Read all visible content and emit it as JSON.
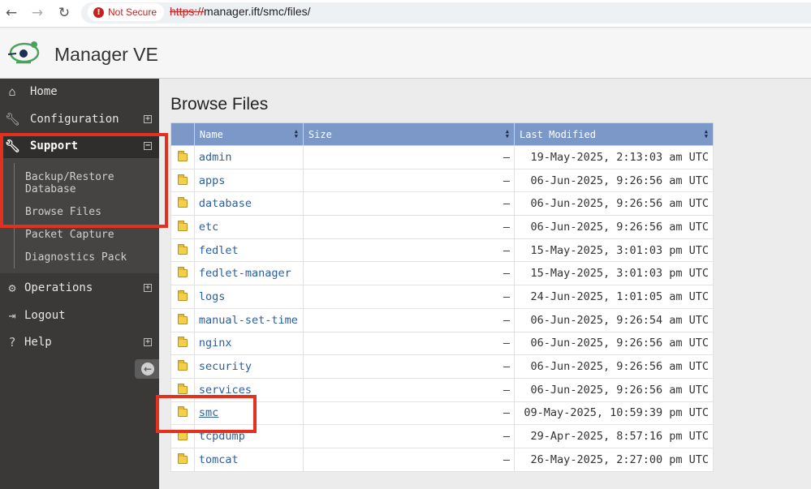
{
  "browser": {
    "url_scheme": "https://",
    "url_rest": "manager.ift/smc/files/",
    "security_label": "Not Secure"
  },
  "app": {
    "title": "Manager VE"
  },
  "sidebar": {
    "items": [
      {
        "label": "Home",
        "icon": "home-icon"
      },
      {
        "label": "Configuration",
        "icon": "wrench-icon"
      },
      {
        "label": "Support",
        "icon": "wrench-icon"
      },
      {
        "label": "Operations",
        "icon": "gears-icon"
      },
      {
        "label": "Logout",
        "icon": "logout-icon"
      },
      {
        "label": "Help",
        "icon": "help-icon"
      }
    ],
    "support_subitems": [
      {
        "label_line1": "Backup/Restore",
        "label_line2": "Database"
      },
      {
        "label": "Browse Files"
      },
      {
        "label": "Packet Capture"
      },
      {
        "label": "Diagnostics Pack"
      }
    ]
  },
  "main": {
    "title": "Browse Files",
    "columns": {
      "name": "Name",
      "size": "Size",
      "modified": "Last Modified"
    },
    "rows": [
      {
        "name": "admin",
        "size": "–",
        "modified": "19-May-2025, 2:13:03 am UTC"
      },
      {
        "name": "apps",
        "size": "–",
        "modified": "06-Jun-2025, 9:26:56 am UTC"
      },
      {
        "name": "database",
        "size": "–",
        "modified": "06-Jun-2025, 9:26:56 am UTC"
      },
      {
        "name": "etc",
        "size": "–",
        "modified": "06-Jun-2025, 9:26:56 am UTC"
      },
      {
        "name": "fedlet",
        "size": "–",
        "modified": "15-May-2025, 3:01:03 pm UTC"
      },
      {
        "name": "fedlet-manager",
        "size": "–",
        "modified": "15-May-2025, 3:01:03 pm UTC"
      },
      {
        "name": "logs",
        "size": "–",
        "modified": "24-Jun-2025, 1:01:05 am UTC"
      },
      {
        "name": "manual-set-time",
        "size": "–",
        "modified": "06-Jun-2025, 9:26:54 am UTC"
      },
      {
        "name": "nginx",
        "size": "–",
        "modified": "06-Jun-2025, 9:26:56 am UTC"
      },
      {
        "name": "security",
        "size": "–",
        "modified": "06-Jun-2025, 9:26:56 am UTC"
      },
      {
        "name": "services",
        "size": "–",
        "modified": "06-Jun-2025, 9:26:56 am UTC"
      },
      {
        "name": "smc",
        "size": "–",
        "modified": "09-May-2025, 10:59:39 pm UTC"
      },
      {
        "name": "tcpdump",
        "size": "–",
        "modified": "29-Apr-2025, 8:57:16 pm UTC"
      },
      {
        "name": "tomcat",
        "size": "–",
        "modified": "26-May-2025, 2:27:00 pm UTC"
      }
    ]
  },
  "colors": {
    "annotation": "#e3311d",
    "table_header": "#7b98c8",
    "sidebar": "#3a3938",
    "link": "#2b5f9e"
  }
}
